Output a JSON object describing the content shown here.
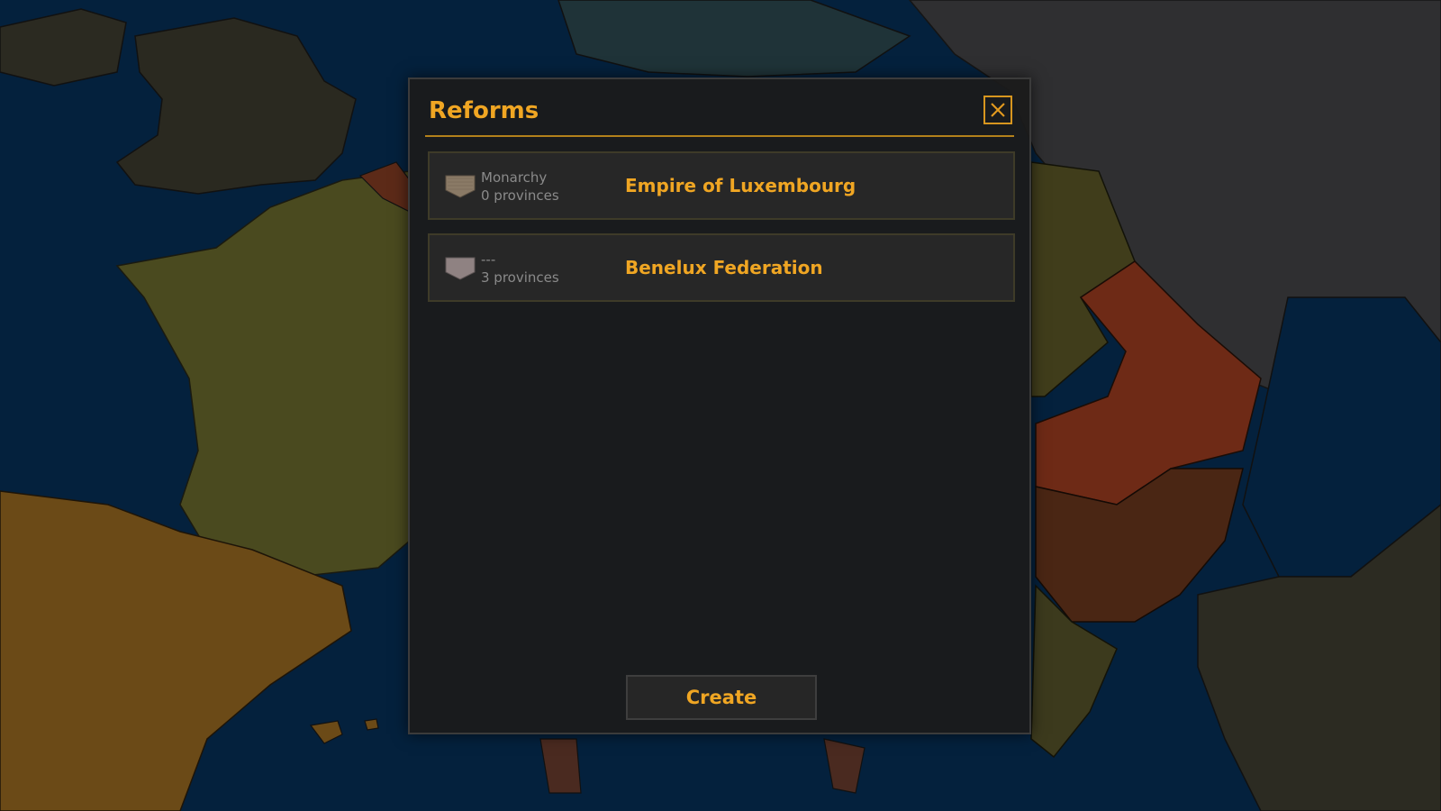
{
  "dialog": {
    "title": "Reforms",
    "close_icon": "close-icon"
  },
  "reform_options": [
    {
      "government": "Monarchy",
      "provinces": "0 provinces",
      "name": "Empire of Luxembourg",
      "flag_icon": "pennant-flag-icon",
      "flag_color": "#8a7a66"
    },
    {
      "government": "---",
      "provinces": "3 provinces",
      "name": "Benelux Federation",
      "flag_icon": "pennant-flag-icon",
      "flag_color": "#8f8282"
    }
  ],
  "actions": {
    "create_label": "Create"
  },
  "colors": {
    "accent": "#f0a623",
    "sea": "#04213d",
    "france": "#4a4a1f",
    "iberia": "#6b4a17",
    "balkans_red": "#6e2a16",
    "east": "#2f2f31"
  }
}
